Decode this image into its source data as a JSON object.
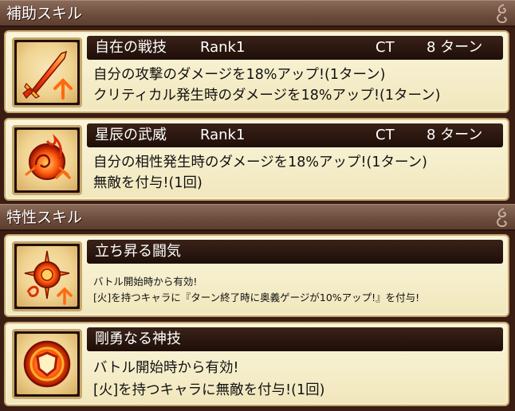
{
  "sections": [
    {
      "title": "補助スキル"
    },
    {
      "title": "特性スキル"
    }
  ],
  "support_skills": [
    {
      "name": "自在の戦技",
      "rank": "Rank1",
      "ct_label": "CT",
      "ct_value": "8 ターン",
      "icon": "sword-icon",
      "lines": [
        "自分の攻撃のダメージを18%アップ!(1ターン)",
        "クリティカル発生時のダメージを18%アップ!(1ターン)"
      ]
    },
    {
      "name": "星辰の武威",
      "rank": "Rank1",
      "ct_label": "CT",
      "ct_value": "8 ターン",
      "icon": "flame-swirl-icon",
      "lines": [
        "自分の相性発生時のダメージを18%アップ!(1ターン)",
        "無敵を付与!(1回)"
      ]
    }
  ],
  "trait_skills": [
    {
      "name": "立ち昇る闘気",
      "icon": "fire-compass-icon",
      "lines": [
        "バトル開始時から有効!",
        "[火]を持つキャラに『ターン終了時に奥義ゲージが10%アップ!』を付与!"
      ]
    },
    {
      "name": "剛勇なる神技",
      "icon": "shield-icon",
      "lines": [
        "バトル開始時から有効!",
        "[火]を持つキャラに無敵を付与!(1回)"
      ]
    }
  ],
  "colors": {
    "header_bg": "#6e4e3e",
    "card_bg": "#f8f0d0",
    "name_bar_bg": "#2a160e",
    "icon_fire": "#e8400c"
  }
}
